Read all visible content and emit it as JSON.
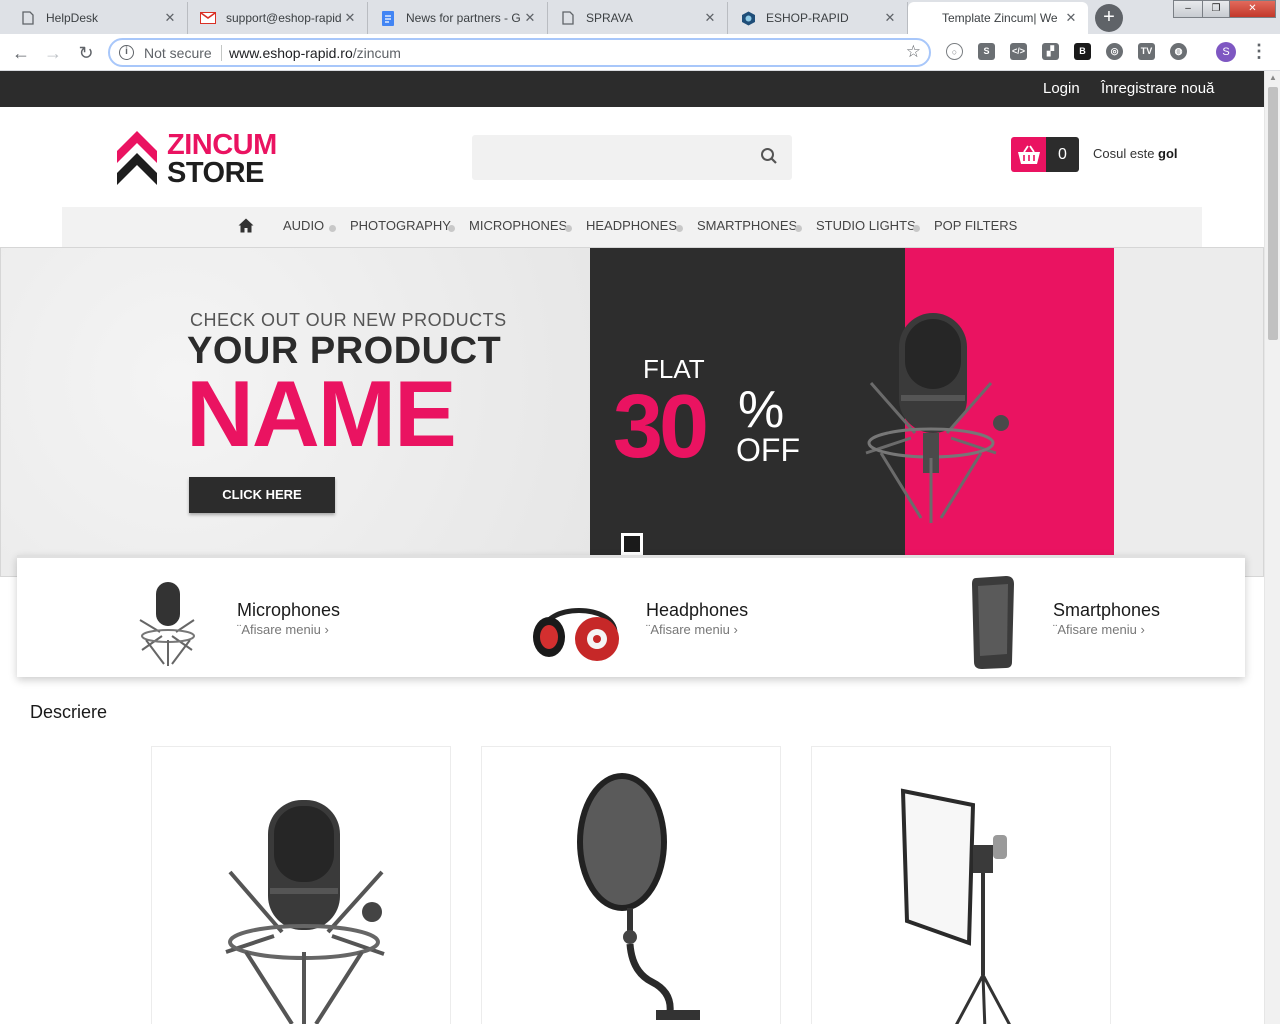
{
  "browser": {
    "tabs": [
      {
        "title": "HelpDesk",
        "icon": "doc-icon"
      },
      {
        "title": "support@eshop-rapid",
        "icon": "gmail-icon"
      },
      {
        "title": "News for partners - G",
        "icon": "docs-icon"
      },
      {
        "title": "SPRAVA",
        "icon": "doc-icon"
      },
      {
        "title": "ESHOP-RAPID",
        "icon": "hex-icon"
      },
      {
        "title": "Template Zincum| We",
        "icon": "",
        "active": true
      }
    ],
    "security_label": "Not secure",
    "url_host": "www.eshop-rapid.ro",
    "url_path": "/zincum",
    "profile_initial": "S"
  },
  "site": {
    "login": "Login",
    "register": "Înregistrare nouă",
    "logo_line1": "ZINCUM",
    "logo_line2": "STORE",
    "search_placeholder": "",
    "cart_count": "0",
    "cart_text": "Cosul este",
    "cart_state": "gol",
    "nav": [
      "AUDIO",
      "PHOTOGRAPHY",
      "MICROPHONES",
      "HEADPHONES",
      "SMARTPHONES",
      "STUDIO LIGHTS",
      "POP FILTERS"
    ],
    "hero": {
      "kicker": "CHECK OUT OUR  NEW PRODUCTS",
      "line1": "YOUR PRODUCT",
      "line2": "NAME",
      "cta": "CLICK HERE",
      "flat": "FLAT",
      "percent": "30",
      "percent_sign": "%",
      "off": "OFF"
    },
    "categories": [
      {
        "name": "Microphones",
        "sub": "¨Afisare meniu"
      },
      {
        "name": "Headphones",
        "sub": "¨Afisare meniu"
      },
      {
        "name": "Smartphones",
        "sub": "¨Afisare meniu"
      }
    ],
    "section_title": "Descriere"
  },
  "colors": {
    "brand_pink": "#ea1361",
    "dark": "#2c2c2c"
  }
}
